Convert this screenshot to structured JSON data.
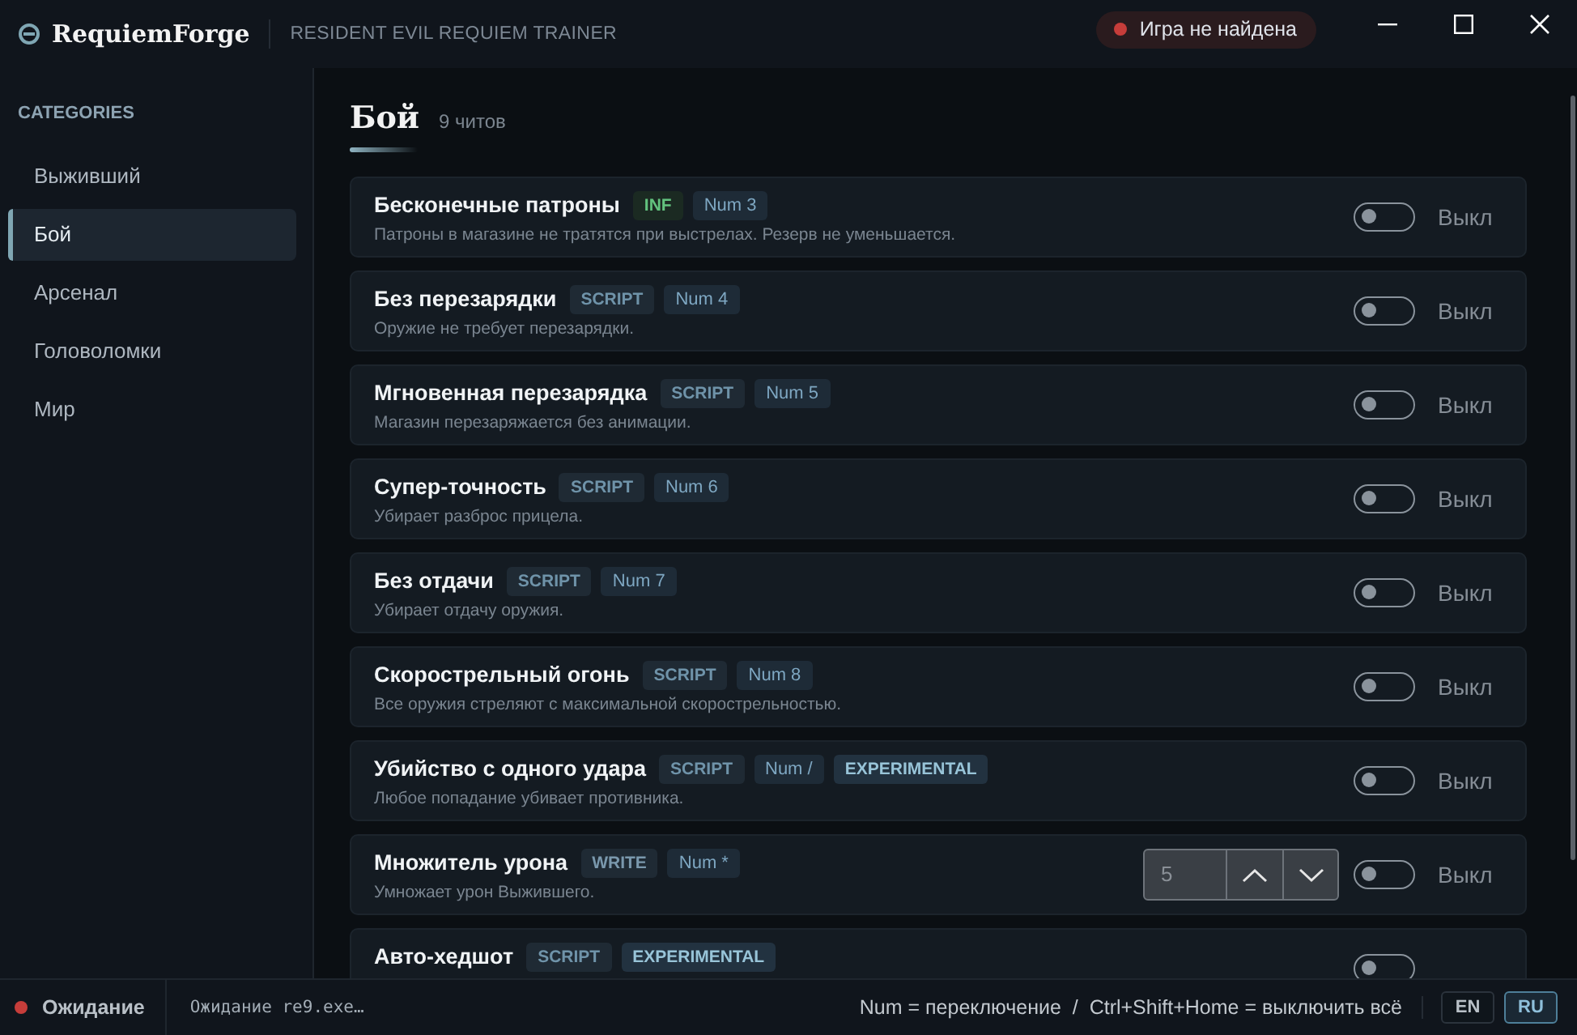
{
  "app": {
    "name": "RequiemForge",
    "subtitle": "RESIDENT EVIL REQUIEM TRAINER"
  },
  "game_status": {
    "label": "Игра не найдена",
    "found": false
  },
  "sidebar": {
    "heading": "CATEGORIES",
    "items": [
      {
        "label": "Выживший",
        "selected": false
      },
      {
        "label": "Бой",
        "selected": true
      },
      {
        "label": "Арсенал",
        "selected": false
      },
      {
        "label": "Головоломки",
        "selected": false
      },
      {
        "label": "Мир",
        "selected": false
      }
    ]
  },
  "section": {
    "title": "Бой",
    "count": "9 читов"
  },
  "cheats": [
    {
      "kind": "toggle",
      "name": "Бесконечные патроны",
      "tags": [
        {
          "kind": "inf",
          "label": "INF"
        },
        {
          "kind": "hotkey",
          "label": "Num 3"
        }
      ],
      "description": "Патроны в магазине не тратятся при выстрелах. Резерв не уменьшается.",
      "on": false,
      "state_label": "Выкл"
    },
    {
      "kind": "toggle",
      "name": "Без перезарядки",
      "tags": [
        {
          "kind": "script",
          "label": "SCRIPT"
        },
        {
          "kind": "hotkey",
          "label": "Num 4"
        }
      ],
      "description": "Оружие не требует перезарядки.",
      "on": false,
      "state_label": "Выкл"
    },
    {
      "kind": "toggle",
      "name": "Мгновенная перезарядка",
      "tags": [
        {
          "kind": "script",
          "label": "SCRIPT"
        },
        {
          "kind": "hotkey",
          "label": "Num 5"
        }
      ],
      "description": "Магазин перезаряжается без анимации.",
      "on": false,
      "state_label": "Выкл"
    },
    {
      "kind": "toggle",
      "name": "Супер-точность",
      "tags": [
        {
          "kind": "script",
          "label": "SCRIPT"
        },
        {
          "kind": "hotkey",
          "label": "Num 6"
        }
      ],
      "description": "Убирает разброс прицела.",
      "on": false,
      "state_label": "Выкл"
    },
    {
      "kind": "toggle",
      "name": "Без отдачи",
      "tags": [
        {
          "kind": "script",
          "label": "SCRIPT"
        },
        {
          "kind": "hotkey",
          "label": "Num 7"
        }
      ],
      "description": "Убирает отдачу оружия.",
      "on": false,
      "state_label": "Выкл"
    },
    {
      "kind": "toggle",
      "name": "Скорострельный огонь",
      "tags": [
        {
          "kind": "script",
          "label": "SCRIPT"
        },
        {
          "kind": "hotkey",
          "label": "Num 8"
        }
      ],
      "description": "Все оружия стреляют с максимальной скорострельностью.",
      "on": false,
      "state_label": "Выкл"
    },
    {
      "kind": "toggle",
      "name": "Убийство с одного удара",
      "tags": [
        {
          "kind": "script",
          "label": "SCRIPT"
        },
        {
          "kind": "hotkey",
          "label": "Num /"
        },
        {
          "kind": "experimental",
          "label": "EXPERIMENTAL"
        }
      ],
      "description": "Любое попадание убивает противника.",
      "on": false,
      "state_label": "Выкл"
    },
    {
      "kind": "number",
      "name": "Множитель урона",
      "tags": [
        {
          "kind": "write",
          "label": "WRITE"
        },
        {
          "kind": "hotkey",
          "label": "Num *"
        }
      ],
      "description": "Умножает урон Выжившего.",
      "value": "5",
      "on": false,
      "state_label": "Выкл"
    },
    {
      "kind": "toggle",
      "name": "Авто-хедшот",
      "tags": [
        {
          "kind": "script",
          "label": "SCRIPT"
        },
        {
          "kind": "experimental",
          "label": "EXPERIMENTAL"
        }
      ],
      "on": false
    }
  ],
  "status_bar": {
    "state": "Ожидание",
    "log": "Ожидание re9.exe…",
    "hint": "Num = переключение  /  Ctrl+Shift+Home = выключить всё",
    "languages": [
      {
        "label": "EN",
        "selected": false
      },
      {
        "label": "RU",
        "selected": true
      }
    ]
  }
}
